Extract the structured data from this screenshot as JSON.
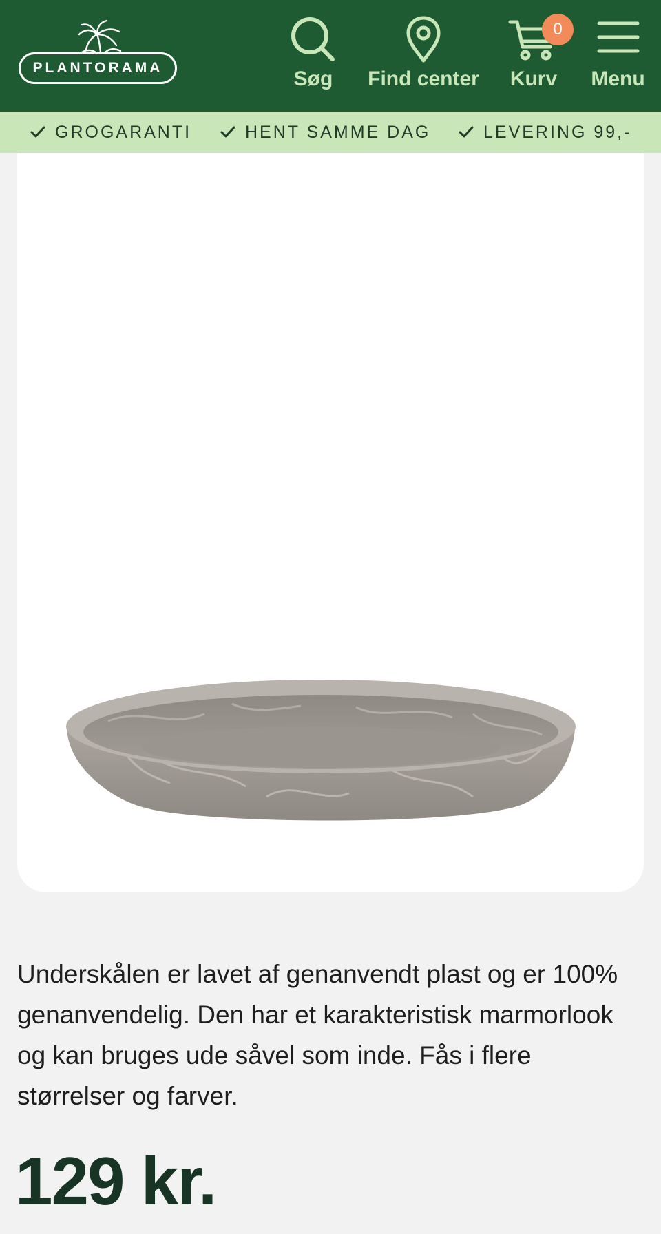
{
  "header": {
    "logo_text": "PLANTORAMA",
    "nav": {
      "search_label": "Søg",
      "center_label": "Find center",
      "cart_label": "Kurv",
      "cart_count": "0",
      "menu_label": "Menu"
    },
    "icons": [
      "palm-logo-icon",
      "search-icon",
      "location-pin-icon",
      "cart-icon",
      "hamburger-menu-icon"
    ]
  },
  "usp_bar": {
    "items": [
      "GROGARANTI",
      "HENT SAMME DAG",
      "LEVERING 99,-"
    ]
  },
  "product": {
    "image_alt_icon": "saucer-image",
    "description": "Underskålen er lavet af genanvendt plast og er 100% genanvendelig. Den har et karakteristisk marmorlook og kan bruges ude såvel som inde. Fås i flere størrelser og farver.",
    "price": "129 kr."
  },
  "colors": {
    "header_bg": "#1e5b33",
    "accent_light_green": "#c8e6b8",
    "badge_orange": "#f28a5a",
    "page_bg": "#f2f2f2",
    "price_text": "#173424"
  }
}
